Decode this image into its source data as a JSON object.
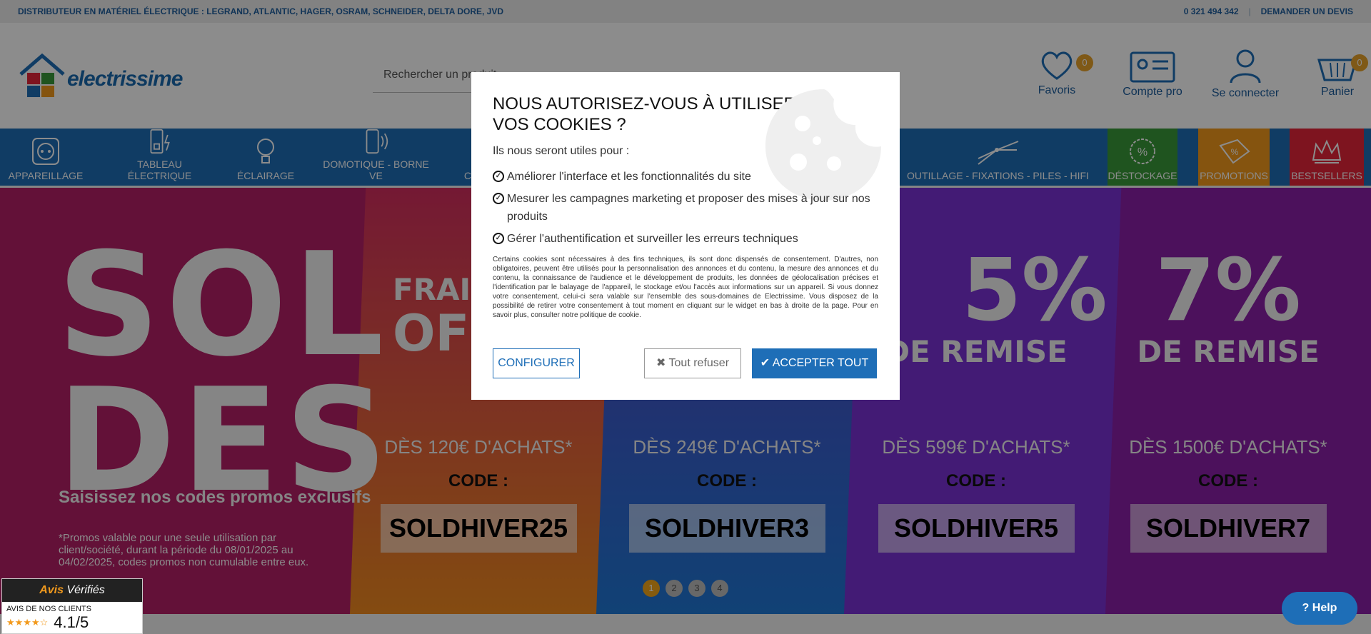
{
  "topbar": {
    "distributor": "DISTRIBUTEUR EN MATÉRIEL ÉLECTRIQUE : LEGRAND, ATLANTIC, HAGER, OSRAM, SCHNEIDER, DELTA DORE, JVD",
    "phone": "0 321 494 342",
    "quote": "DEMANDER UN DEVIS"
  },
  "logo": {
    "text": "electrissime"
  },
  "search": {
    "placeholder": "Rechercher un produit"
  },
  "header_icons": {
    "favoris": {
      "label": "Favoris",
      "count": "0",
      "icon": "heart-icon"
    },
    "compte_pro": {
      "label": "Compte pro",
      "icon": "pro-account-icon"
    },
    "connect": {
      "label": "Se connecter",
      "icon": "user-icon"
    },
    "panier": {
      "label": "Panier",
      "count": "0",
      "icon": "cart-icon"
    }
  },
  "nav": {
    "items": [
      {
        "label": "APPAREILLAGE"
      },
      {
        "label": "TABLEAU ÉLECTRIQUE"
      },
      {
        "label": "ÉCLAIRAGE"
      },
      {
        "label": "DOMOTIQUE - BORNE VE"
      },
      {
        "label": "CH"
      },
      {
        "label": "OUTILLAGE - FIXATIONS - PILES - HIFI"
      },
      {
        "label": "DÉSTOCKAGE"
      },
      {
        "label": "PROMOTIONS"
      },
      {
        "label": "BESTSELLERS"
      }
    ]
  },
  "banner": {
    "sol": "SOL",
    "des": "DES",
    "subtitle": "Saisissez nos codes promos exclusifs",
    "note": "*Promos valable pour une seule utilisation par client/société, durant la période du 08/01/2025 au 04/02/2025, codes promos non cumulable entre eux.",
    "offers": [
      {
        "line1": "FRAIS",
        "line2": "OFF",
        "threshold": "DÈS 120€ D'ACHATS*",
        "code_label": "CODE :",
        "code": "SOLDHIVER25"
      },
      {
        "line1": "",
        "line2": "",
        "threshold": "DÈS 249€ D'ACHATS*",
        "code_label": "CODE :",
        "code": "SOLDHIVER3"
      },
      {
        "line1": "5%",
        "line2": "DE REMISE",
        "threshold": "DÈS 599€ D'ACHATS*",
        "code_label": "CODE :",
        "code": "SOLDHIVER5"
      },
      {
        "line1": "7%",
        "line2": "DE REMISE",
        "threshold": "DÈS 1500€ D'ACHATS*",
        "code_label": "CODE :",
        "code": "SOLDHIVER7"
      }
    ],
    "dots": [
      "1",
      "2",
      "3",
      "4"
    ],
    "active_dot": "1"
  },
  "modal": {
    "title": "NOUS AUTORISEZ-VOUS À UTILISER VOS COOKIES ?",
    "intro": "Ils nous seront utiles pour :",
    "items": [
      "Améliorer l'interface et les fonctionnalités du site",
      "Mesurer les campagnes marketing et proposer des mises à jour sur nos produits",
      "Gérer l'authentification et surveiller les erreurs techniques"
    ],
    "small": "Certains cookies sont nécessaires à des fins techniques, ils sont donc dispensés de consentement. D'autres, non obligatoires, peuvent être utilisés pour la personnalisation des annonces et du contenu, la mesure des annonces et du contenu, la connaissance de l'audience et le développement de produits, les données de géolocalisation précises et l'identification par le balayage de l'appareil, le stockage et/ou l'accès aux informations sur un appareil. Si vous donnez votre consentement, celui-ci sera valable sur l'ensemble des sous-domaines de Electrissime. Vous disposez de la possibilité de retirer votre consentement à tout moment en cliquant sur le widget en bas à droite de la page. Pour en savoir plus, consulter notre politique de cookie.",
    "configure": "CONFIGURER",
    "refuse": "Tout refuser",
    "accept": "ACCEPTER TOUT"
  },
  "reviews": {
    "brand_a": "Avis",
    "brand_b": "Vérifiés",
    "label": "AVIS DE NOS CLIENTS",
    "stars": "★★★★☆",
    "score": "4.1/5"
  },
  "help": {
    "label": "Help"
  },
  "colors": {
    "brand_blue": "#1e6eb7",
    "accent_orange": "#f29a1d",
    "destockage_green": "#3a9a3a",
    "bestsellers_red": "#e5263a"
  }
}
